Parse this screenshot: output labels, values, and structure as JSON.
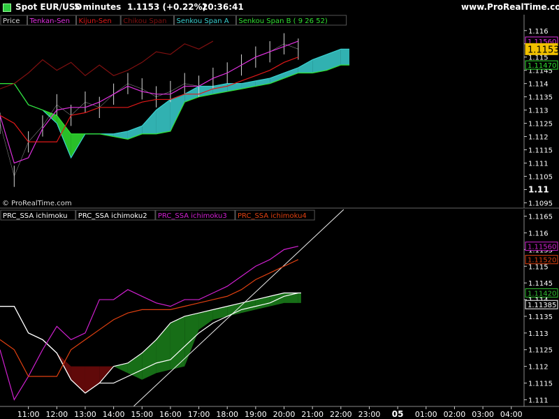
{
  "header": {
    "instrument": "Spot EUR/USD",
    "timeframe": "5 minutes",
    "price_change": "1.1153 (+0.22%)",
    "time": "20:36:41",
    "brand": "www.ProRealTime.com",
    "watermark": "© ProRealTime.com"
  },
  "colors": {
    "background": "#000000",
    "price": "#d8d8d8",
    "tenkan": "#e030e0",
    "kijun": "#e01818",
    "chikou": "#801010",
    "span_a": "#3ad0d0",
    "span_b": "#30e030",
    "ichimoku": "#ffffff",
    "ichimoku2": "#ffffff",
    "ichimoku3": "#d020d0",
    "ichimoku4": "#e04010",
    "cloud_bull": "#1a7a1a",
    "cloud_bear": "#6a0a0a",
    "label_current": "#f0c000"
  },
  "chart_data": [
    {
      "type": "line",
      "panel": "top",
      "legend": [
        "Price",
        "Tenkan-Sen",
        "Kijun-Sen",
        "Chikou Span",
        "Senkou Span A",
        "Senkou Span B ( 9 26 52)"
      ],
      "y_ticks": [
        "1.116",
        "1.1155",
        "1.115",
        "1.1145",
        "1.114",
        "1.1135",
        "1.113",
        "1.1125",
        "1.112",
        "1.1115",
        "1.111",
        "1.1105",
        "1.11",
        "1.1095"
      ],
      "ylim": [
        1.1093,
        1.1166
      ],
      "price_labels": [
        {
          "text": "1.11560",
          "value": 1.1156,
          "color": "#e030e0"
        },
        {
          "text": "1.1153",
          "value": 1.1153,
          "color": "#f0c000"
        },
        {
          "text": "1.11470",
          "value": 1.1147,
          "color": "#30e030"
        }
      ],
      "x": [
        10.0,
        10.5,
        11.0,
        11.5,
        12.0,
        12.5,
        13.0,
        13.5,
        14.0,
        14.5,
        15.0,
        15.5,
        16.0,
        16.5,
        17.0,
        17.5,
        18.0,
        18.5,
        19.0,
        19.5,
        20.0,
        20.5
      ],
      "series": [
        {
          "name": "Price",
          "values": [
            1.1125,
            1.1105,
            1.1118,
            1.1124,
            1.1132,
            1.1128,
            1.1133,
            1.1131,
            1.1136,
            1.114,
            1.1138,
            1.1135,
            1.1137,
            1.114,
            1.1139,
            1.1142,
            1.1144,
            1.1147,
            1.115,
            1.1152,
            1.1155,
            1.1153
          ]
        },
        {
          "name": "Tenkan-Sen",
          "values": [
            1.1128,
            1.111,
            1.1112,
            1.1123,
            1.113,
            1.1131,
            1.1131,
            1.1133,
            1.1136,
            1.1139,
            1.1137,
            1.1136,
            1.1136,
            1.1139,
            1.1139,
            1.1142,
            1.1144,
            1.1147,
            1.115,
            1.1152,
            1.1154,
            1.1156
          ]
        },
        {
          "name": "Kijun-Sen",
          "values": [
            1.1128,
            1.1125,
            1.1118,
            1.1118,
            1.1118,
            1.1128,
            1.1129,
            1.1131,
            1.1131,
            1.1131,
            1.1133,
            1.1134,
            1.1134,
            1.1136,
            1.1136,
            1.1138,
            1.1139,
            1.1141,
            1.1143,
            1.1145,
            1.1148,
            1.115
          ]
        },
        {
          "name": "Chikou Span",
          "values": [
            1.1138,
            1.114,
            1.1144,
            1.1149,
            1.1145,
            1.1148,
            1.1143,
            1.1147,
            1.1143,
            1.1145,
            1.1148,
            1.1152,
            1.1151,
            1.1155,
            1.1153,
            1.1156
          ]
        }
      ],
      "cloud": {
        "x": [
          10.0,
          10.5,
          11.0,
          11.5,
          12.0,
          12.5,
          13.0,
          13.5,
          14.0,
          14.5,
          15.0,
          15.5,
          16.0,
          16.5,
          17.0,
          17.5,
          18.0,
          18.5,
          19.0,
          19.5,
          20.0,
          20.5,
          21.0,
          21.5,
          22.0,
          22.3
        ],
        "span_a": [
          1.114,
          1.114,
          1.1132,
          1.113,
          1.1125,
          1.1112,
          1.1121,
          1.1121,
          1.1121,
          1.1122,
          1.1124,
          1.113,
          1.1134,
          1.1136,
          1.1139,
          1.1139,
          1.114,
          1.114,
          1.1141,
          1.1142,
          1.1144,
          1.1146,
          1.1149,
          1.1151,
          1.1153,
          1.1153
        ],
        "span_b": [
          1.114,
          1.114,
          1.1132,
          1.113,
          1.1128,
          1.1121,
          1.1121,
          1.1121,
          1.112,
          1.1119,
          1.1121,
          1.1121,
          1.1122,
          1.1133,
          1.1135,
          1.1136,
          1.1137,
          1.1138,
          1.1139,
          1.114,
          1.1142,
          1.1144,
          1.1144,
          1.1145,
          1.1147,
          1.1147
        ]
      }
    },
    {
      "type": "line",
      "panel": "bottom",
      "legend": [
        "PRC_SSA ichimoku",
        "PRC_SSA ichimoku2",
        "PRC_SSA ichimoku3",
        "PRC_SSA ichimoku4"
      ],
      "y_ticks": [
        "1.1165",
        "1.116",
        "1.1155",
        "1.115",
        "1.1145",
        "1.114",
        "1.1135",
        "1.113",
        "1.1125",
        "1.112",
        "1.1115",
        "1.111"
      ],
      "ylim": [
        1.1108,
        1.1167
      ],
      "price_labels": [
        {
          "text": "1.11560",
          "value": 1.1156,
          "color": "#d020d0"
        },
        {
          "text": "1.11520",
          "value": 1.1152,
          "color": "#e04010"
        },
        {
          "text": "1.11420",
          "value": 1.1142,
          "color": "#30c030"
        },
        {
          "text": "1.11385",
          "value": 1.11385,
          "color": "#ffffff"
        }
      ],
      "x": [
        10.0,
        10.5,
        11.0,
        11.5,
        12.0,
        12.5,
        13.0,
        13.5,
        14.0,
        14.5,
        15.0,
        15.5,
        16.0,
        16.5,
        17.0,
        17.5,
        18.0,
        18.5,
        19.0,
        19.5,
        20.0,
        20.5
      ],
      "series": [
        {
          "name": "PRC_SSA ichimoku",
          "values": [
            1.1138,
            1.1138,
            1.113,
            1.1128,
            1.1124,
            1.1116,
            1.1112,
            1.1115,
            1.1115,
            1.1117,
            1.1119,
            1.1121,
            1.1122,
            1.1126,
            1.113,
            1.1133,
            1.1135,
            1.1137,
            1.1138,
            1.1139,
            1.1141,
            1.1142
          ]
        },
        {
          "name": "PRC_SSA ichimoku3",
          "values": [
            1.1125,
            1.111,
            1.1117,
            1.1125,
            1.1132,
            1.1128,
            1.113,
            1.114,
            1.114,
            1.1143,
            1.1141,
            1.1139,
            1.1138,
            1.114,
            1.114,
            1.1142,
            1.1144,
            1.1147,
            1.115,
            1.1152,
            1.1155,
            1.1156
          ]
        },
        {
          "name": "PRC_SSA ichimoku4",
          "values": [
            1.1128,
            1.1125,
            1.1117,
            1.1117,
            1.1117,
            1.1125,
            1.1128,
            1.1131,
            1.1134,
            1.1136,
            1.1137,
            1.1137,
            1.1137,
            1.1138,
            1.1139,
            1.114,
            1.1141,
            1.1143,
            1.1146,
            1.1148,
            1.115,
            1.1152
          ]
        }
      ],
      "cloud": {
        "x": [
          10.0,
          10.5,
          11.0,
          11.5,
          12.0,
          12.5,
          13.0,
          13.5,
          14.0,
          14.5,
          15.0,
          15.5,
          16.0,
          16.5,
          17.0,
          17.5,
          18.0,
          18.5,
          19.0,
          19.5,
          20.0,
          20.5,
          20.6
        ],
        "span_a": [
          1.1138,
          1.1138,
          1.113,
          1.1128,
          1.1124,
          1.1116,
          1.1112,
          1.1115,
          1.112,
          1.1121,
          1.1124,
          1.1128,
          1.1133,
          1.1135,
          1.1136,
          1.1137,
          1.1138,
          1.1139,
          1.114,
          1.1141,
          1.1142,
          1.1142,
          1.1142
        ],
        "span_b": [
          1.1138,
          1.1138,
          1.113,
          1.1128,
          1.1124,
          1.112,
          1.112,
          1.112,
          1.112,
          1.1118,
          1.1116,
          1.1118,
          1.1119,
          1.112,
          1.1131,
          1.1134,
          1.1135,
          1.1136,
          1.1137,
          1.1138,
          1.1139,
          1.1139,
          1.1139
        ]
      },
      "trendline": {
        "x": [
          14.7,
          22.1
        ],
        "y": [
          1.1108,
          1.1167
        ]
      }
    }
  ],
  "x_axis": {
    "labels": [
      "11:00",
      "12:00",
      "13:00",
      "14:00",
      "15:00",
      "16:00",
      "17:00",
      "18:00",
      "19:00",
      "20:00",
      "21:00",
      "22:00",
      "23:00",
      "05",
      "01:00",
      "02:00",
      "03:00",
      "04:00"
    ],
    "values": [
      11,
      12,
      13,
      14,
      15,
      16,
      17,
      18,
      19,
      20,
      21,
      22,
      23,
      24,
      25,
      26,
      27,
      28
    ],
    "range": [
      10.0,
      28.4
    ]
  }
}
